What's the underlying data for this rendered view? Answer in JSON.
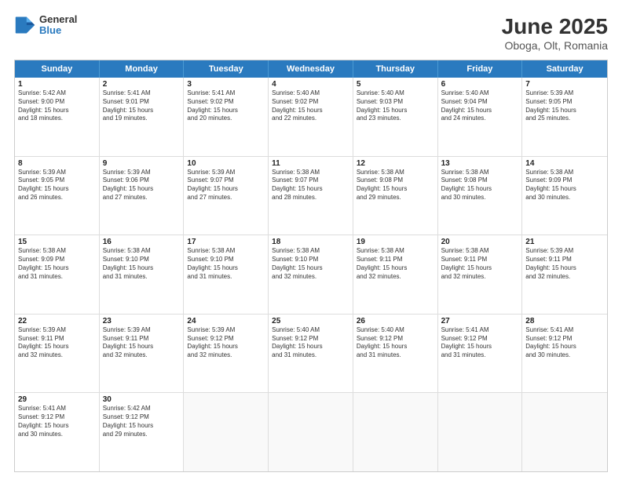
{
  "header": {
    "title": "June 2025",
    "subtitle": "Oboga, Olt, Romania",
    "logo_general": "General",
    "logo_blue": "Blue"
  },
  "weekdays": [
    "Sunday",
    "Monday",
    "Tuesday",
    "Wednesday",
    "Thursday",
    "Friday",
    "Saturday"
  ],
  "rows": [
    [
      {
        "day": "1",
        "lines": [
          "Sunrise: 5:42 AM",
          "Sunset: 9:00 PM",
          "Daylight: 15 hours",
          "and 18 minutes."
        ]
      },
      {
        "day": "2",
        "lines": [
          "Sunrise: 5:41 AM",
          "Sunset: 9:01 PM",
          "Daylight: 15 hours",
          "and 19 minutes."
        ]
      },
      {
        "day": "3",
        "lines": [
          "Sunrise: 5:41 AM",
          "Sunset: 9:02 PM",
          "Daylight: 15 hours",
          "and 20 minutes."
        ]
      },
      {
        "day": "4",
        "lines": [
          "Sunrise: 5:40 AM",
          "Sunset: 9:02 PM",
          "Daylight: 15 hours",
          "and 22 minutes."
        ]
      },
      {
        "day": "5",
        "lines": [
          "Sunrise: 5:40 AM",
          "Sunset: 9:03 PM",
          "Daylight: 15 hours",
          "and 23 minutes."
        ]
      },
      {
        "day": "6",
        "lines": [
          "Sunrise: 5:40 AM",
          "Sunset: 9:04 PM",
          "Daylight: 15 hours",
          "and 24 minutes."
        ]
      },
      {
        "day": "7",
        "lines": [
          "Sunrise: 5:39 AM",
          "Sunset: 9:05 PM",
          "Daylight: 15 hours",
          "and 25 minutes."
        ]
      }
    ],
    [
      {
        "day": "8",
        "lines": [
          "Sunrise: 5:39 AM",
          "Sunset: 9:05 PM",
          "Daylight: 15 hours",
          "and 26 minutes."
        ]
      },
      {
        "day": "9",
        "lines": [
          "Sunrise: 5:39 AM",
          "Sunset: 9:06 PM",
          "Daylight: 15 hours",
          "and 27 minutes."
        ]
      },
      {
        "day": "10",
        "lines": [
          "Sunrise: 5:39 AM",
          "Sunset: 9:07 PM",
          "Daylight: 15 hours",
          "and 27 minutes."
        ]
      },
      {
        "day": "11",
        "lines": [
          "Sunrise: 5:38 AM",
          "Sunset: 9:07 PM",
          "Daylight: 15 hours",
          "and 28 minutes."
        ]
      },
      {
        "day": "12",
        "lines": [
          "Sunrise: 5:38 AM",
          "Sunset: 9:08 PM",
          "Daylight: 15 hours",
          "and 29 minutes."
        ]
      },
      {
        "day": "13",
        "lines": [
          "Sunrise: 5:38 AM",
          "Sunset: 9:08 PM",
          "Daylight: 15 hours",
          "and 30 minutes."
        ]
      },
      {
        "day": "14",
        "lines": [
          "Sunrise: 5:38 AM",
          "Sunset: 9:09 PM",
          "Daylight: 15 hours",
          "and 30 minutes."
        ]
      }
    ],
    [
      {
        "day": "15",
        "lines": [
          "Sunrise: 5:38 AM",
          "Sunset: 9:09 PM",
          "Daylight: 15 hours",
          "and 31 minutes."
        ]
      },
      {
        "day": "16",
        "lines": [
          "Sunrise: 5:38 AM",
          "Sunset: 9:10 PM",
          "Daylight: 15 hours",
          "and 31 minutes."
        ]
      },
      {
        "day": "17",
        "lines": [
          "Sunrise: 5:38 AM",
          "Sunset: 9:10 PM",
          "Daylight: 15 hours",
          "and 31 minutes."
        ]
      },
      {
        "day": "18",
        "lines": [
          "Sunrise: 5:38 AM",
          "Sunset: 9:10 PM",
          "Daylight: 15 hours",
          "and 32 minutes."
        ]
      },
      {
        "day": "19",
        "lines": [
          "Sunrise: 5:38 AM",
          "Sunset: 9:11 PM",
          "Daylight: 15 hours",
          "and 32 minutes."
        ]
      },
      {
        "day": "20",
        "lines": [
          "Sunrise: 5:38 AM",
          "Sunset: 9:11 PM",
          "Daylight: 15 hours",
          "and 32 minutes."
        ]
      },
      {
        "day": "21",
        "lines": [
          "Sunrise: 5:39 AM",
          "Sunset: 9:11 PM",
          "Daylight: 15 hours",
          "and 32 minutes."
        ]
      }
    ],
    [
      {
        "day": "22",
        "lines": [
          "Sunrise: 5:39 AM",
          "Sunset: 9:11 PM",
          "Daylight: 15 hours",
          "and 32 minutes."
        ]
      },
      {
        "day": "23",
        "lines": [
          "Sunrise: 5:39 AM",
          "Sunset: 9:11 PM",
          "Daylight: 15 hours",
          "and 32 minutes."
        ]
      },
      {
        "day": "24",
        "lines": [
          "Sunrise: 5:39 AM",
          "Sunset: 9:12 PM",
          "Daylight: 15 hours",
          "and 32 minutes."
        ]
      },
      {
        "day": "25",
        "lines": [
          "Sunrise: 5:40 AM",
          "Sunset: 9:12 PM",
          "Daylight: 15 hours",
          "and 31 minutes."
        ]
      },
      {
        "day": "26",
        "lines": [
          "Sunrise: 5:40 AM",
          "Sunset: 9:12 PM",
          "Daylight: 15 hours",
          "and 31 minutes."
        ]
      },
      {
        "day": "27",
        "lines": [
          "Sunrise: 5:41 AM",
          "Sunset: 9:12 PM",
          "Daylight: 15 hours",
          "and 31 minutes."
        ]
      },
      {
        "day": "28",
        "lines": [
          "Sunrise: 5:41 AM",
          "Sunset: 9:12 PM",
          "Daylight: 15 hours",
          "and 30 minutes."
        ]
      }
    ],
    [
      {
        "day": "29",
        "lines": [
          "Sunrise: 5:41 AM",
          "Sunset: 9:12 PM",
          "Daylight: 15 hours",
          "and 30 minutes."
        ]
      },
      {
        "day": "30",
        "lines": [
          "Sunrise: 5:42 AM",
          "Sunset: 9:12 PM",
          "Daylight: 15 hours",
          "and 29 minutes."
        ]
      },
      {
        "day": "",
        "lines": []
      },
      {
        "day": "",
        "lines": []
      },
      {
        "day": "",
        "lines": []
      },
      {
        "day": "",
        "lines": []
      },
      {
        "day": "",
        "lines": []
      }
    ]
  ]
}
